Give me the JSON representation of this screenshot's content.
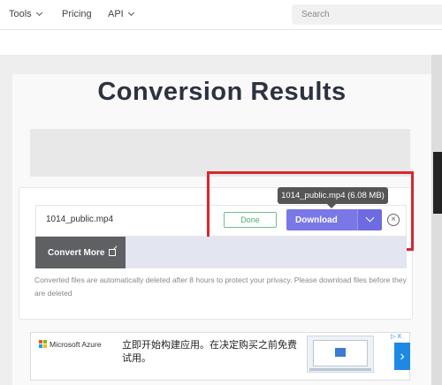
{
  "nav": {
    "tools": "Tools",
    "pricing": "Pricing",
    "api": "API",
    "search_placeholder": "Search"
  },
  "page": {
    "title": "Conversion Results"
  },
  "result": {
    "file_name": "1014_public.mp4",
    "status": "Done",
    "download_label": "Download",
    "tooltip": "1014_public.mp4 (6.08 MB)",
    "close_symbol": "×"
  },
  "actions": {
    "convert_more": "Convert More"
  },
  "notice": "Converted files are automatically deleted after 8 hours to protect your privacy. Please download files before they are deleted",
  "ad": {
    "brand": "Microsoft Azure",
    "text": "立即开始构建应用。在决定购买之前免费试用。",
    "arrow": "›",
    "marks": "▷ X"
  },
  "colors": {
    "accent": "#7a77e6",
    "done": "#4caf6e",
    "highlight": "#d9262e",
    "convert_more_bg": "#5f6064"
  }
}
